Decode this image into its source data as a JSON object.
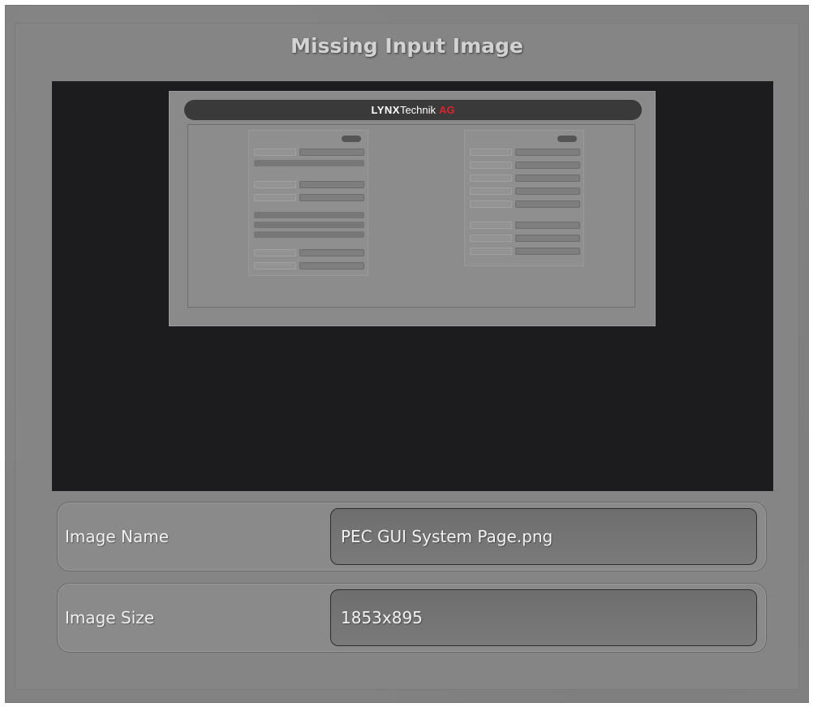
{
  "dialog": {
    "title": "Missing Input Image"
  },
  "preview": {
    "logo_lynx": "LYNX",
    "logo_technik": "Technik",
    "logo_ag": "AG"
  },
  "fields": {
    "image_name_label": "Image Name",
    "image_name_value": "PEC GUI System Page.png",
    "image_size_label": "Image Size",
    "image_size_value": "1853x895"
  }
}
